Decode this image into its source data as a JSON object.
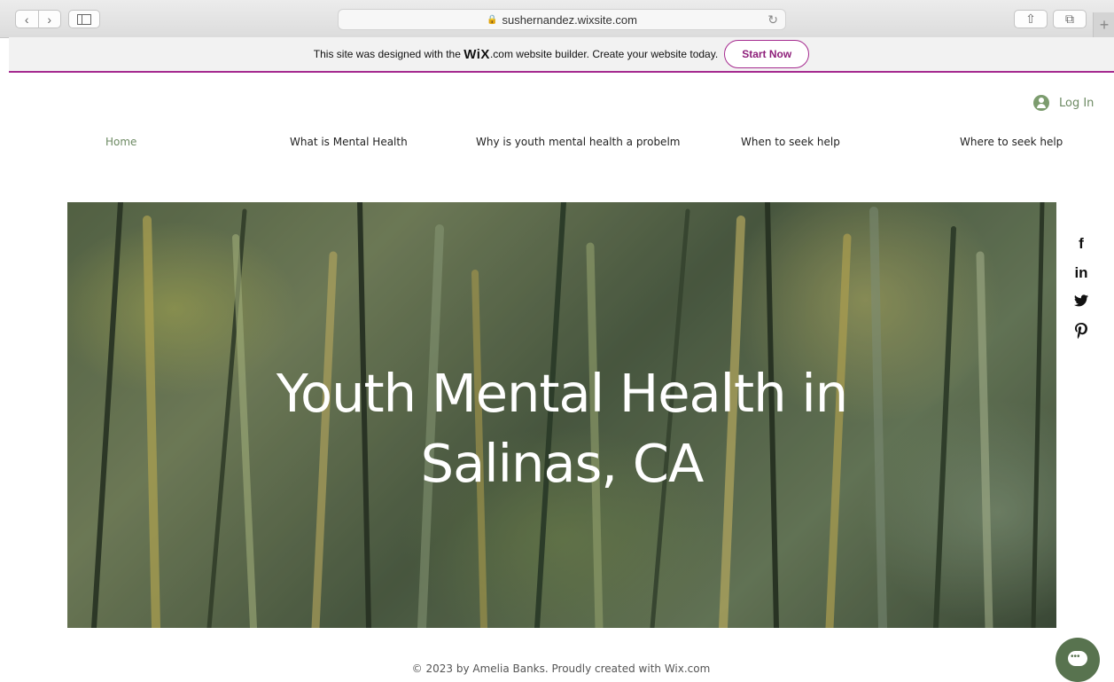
{
  "browser": {
    "back_glyph": "‹",
    "forward_glyph": "›",
    "url": "sushernandez.wixsite.com",
    "lock_glyph": "🔒",
    "reload_glyph": "↻",
    "share_glyph": "⇧",
    "tabs_glyph": "⧉",
    "new_tab_glyph": "+"
  },
  "wix_banner": {
    "text_before": "This site was designed with the",
    "logo": "WiX",
    "text_after": ".com website builder. Create your website today.",
    "button": "Start Now",
    "accent": "#a52a8f"
  },
  "header": {
    "login_label": "Log In",
    "accent": "#6d8a63"
  },
  "nav": {
    "items": [
      {
        "label": "Home",
        "active": true
      },
      {
        "label": "What is Mental Health"
      },
      {
        "label": "Why is youth mental health a probelm"
      },
      {
        "label": "When to seek help"
      },
      {
        "label": "Where to seek help"
      }
    ]
  },
  "hero": {
    "title_line1": "Youth Mental Health in",
    "title_line2": "Salinas, CA"
  },
  "social": {
    "icons": [
      {
        "name": "facebook-icon",
        "glyph": "f"
      },
      {
        "name": "linkedin-icon",
        "glyph": "in"
      },
      {
        "name": "twitter-icon",
        "glyph": "🐦"
      },
      {
        "name": "pinterest-icon",
        "glyph": "𝓅"
      }
    ]
  },
  "footer": {
    "text": "© 2023 by Amelia Banks. Proudly created with Wix.com"
  }
}
